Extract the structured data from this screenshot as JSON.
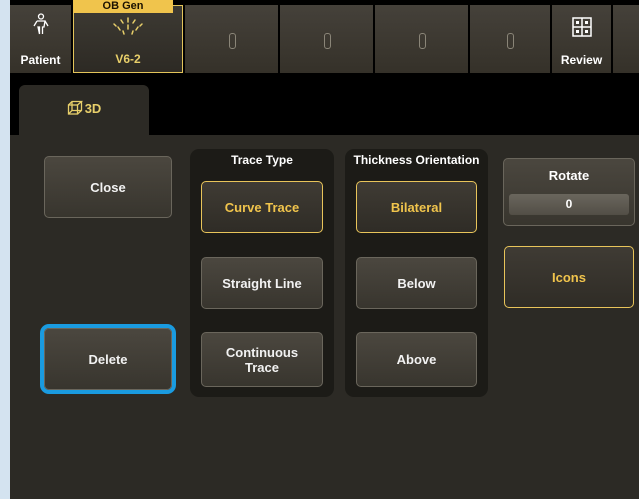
{
  "topbar": {
    "patient_label": "Patient",
    "patient_icon": "person-icon",
    "probe_tag": "OB Gen",
    "probe_label": "V6-2",
    "probe_icon": "sunburst-icon",
    "review_label": "Review",
    "review_icon": "grid-icon"
  },
  "tab": {
    "label": "3D",
    "icon": "cube-icon"
  },
  "buttons": {
    "close": "Close",
    "delete": "Delete"
  },
  "trace_type": {
    "title": "Trace Type",
    "options": [
      "Curve Trace",
      "Straight Line",
      "Continuous Trace"
    ],
    "selected": "Curve Trace"
  },
  "thickness": {
    "title": "Thickness Orientation",
    "options": [
      "Bilateral",
      "Below",
      "Above"
    ],
    "selected": "Bilateral"
  },
  "rotate": {
    "label": "Rotate",
    "value": "0"
  },
  "icons_label": "Icons",
  "colors": {
    "accent": "#f0c44c",
    "focus_ring": "#1a9be0",
    "background": "#d4e3f0",
    "panel": "#2c2a25"
  }
}
